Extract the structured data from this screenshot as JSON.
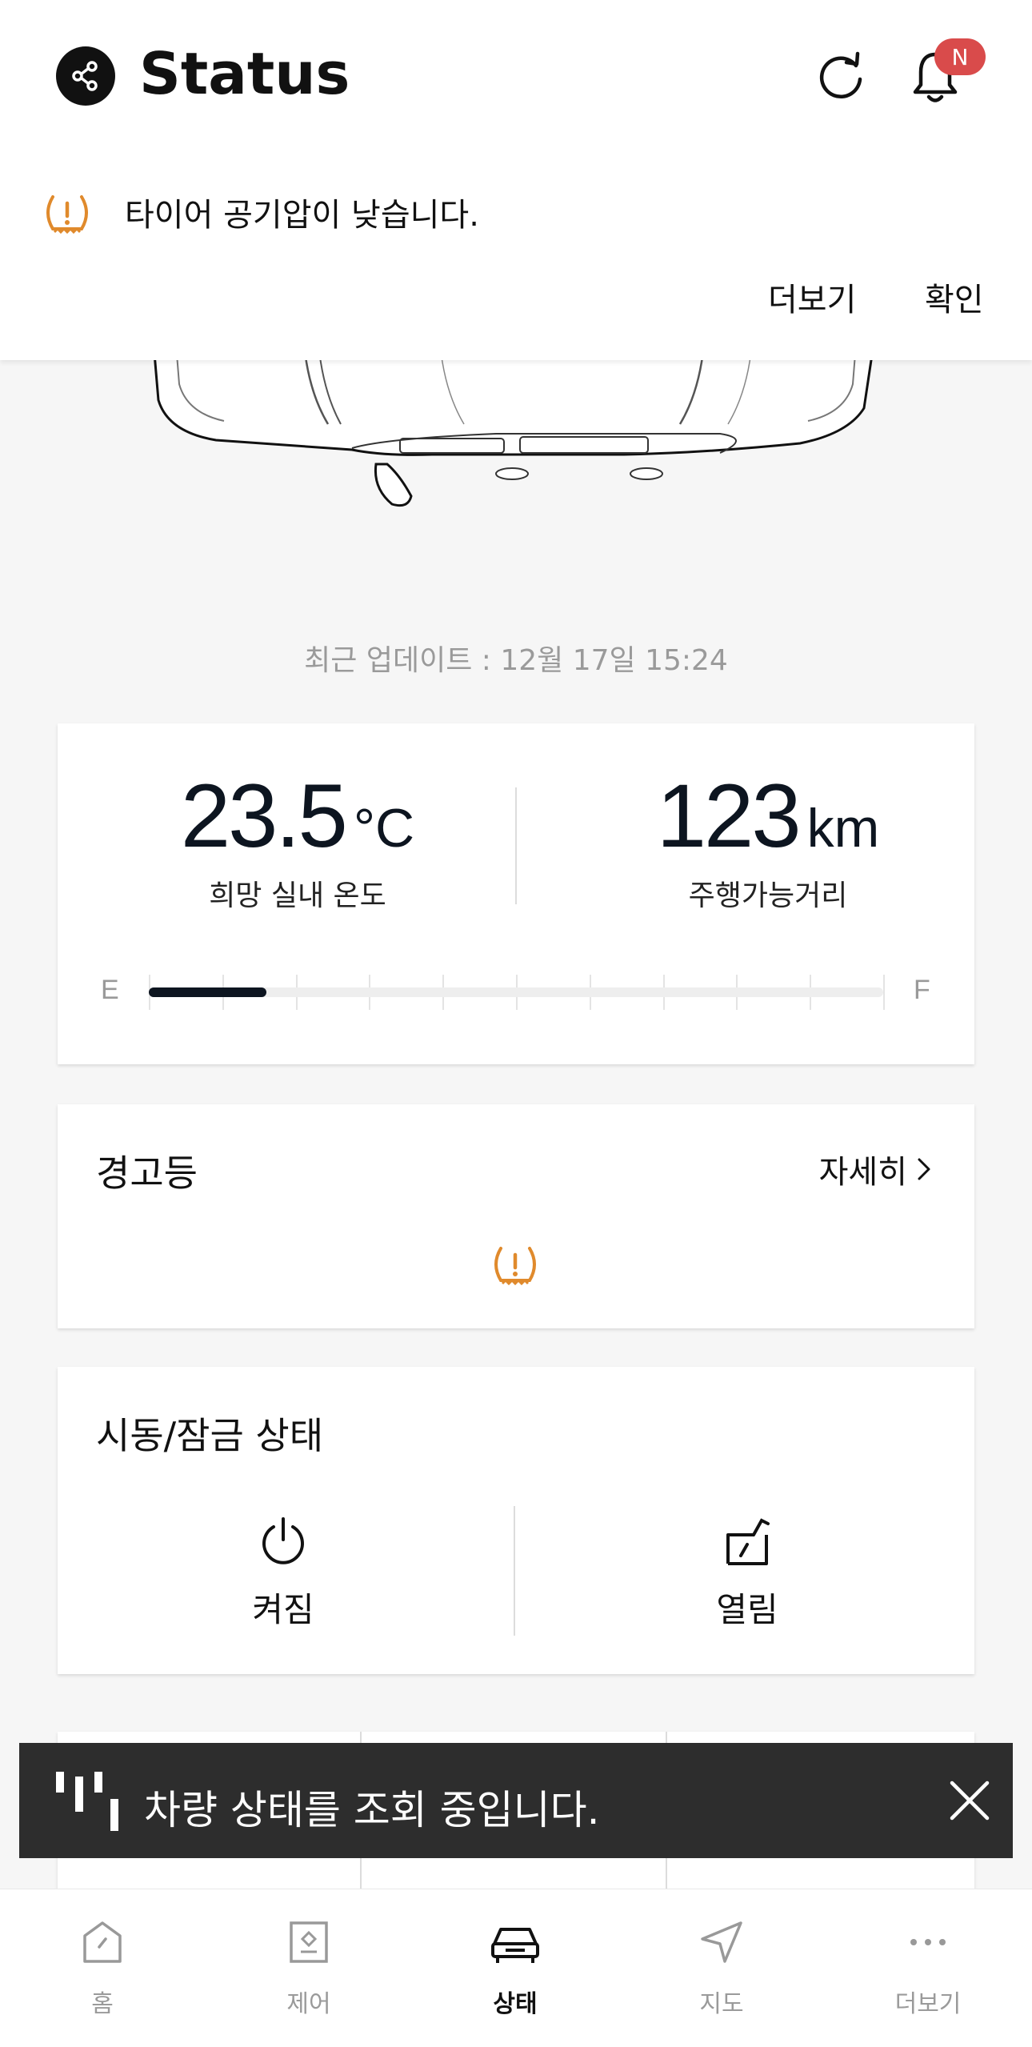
{
  "header": {
    "title": "Status",
    "notification_badge": "N",
    "alert": {
      "message": "타이어 공기압이 낮습니다.",
      "more_label": "더보기",
      "confirm_label": "확인",
      "icon": "tire-pressure-warning-icon",
      "color": "#e08a2c"
    }
  },
  "last_updated": "최근 업데이트 : 12월 17일 15:24",
  "climate": {
    "temperature_value": "23.5",
    "temperature_unit": "°C",
    "temperature_label": "희망 실내 온도",
    "range_value": "123",
    "range_unit": "km",
    "range_label": "주행가능거리"
  },
  "fuel": {
    "empty_label": "E",
    "full_label": "F",
    "level": 0.16
  },
  "warning_lights": {
    "title": "경고등",
    "detail_label": "자세히",
    "icons": [
      "tire-pressure-warning-icon"
    ]
  },
  "lock_status": {
    "title": "시동/잠금 상태",
    "engine_label": "켜짐",
    "door_label": "열림"
  },
  "toast": {
    "message": "차량 상태를 조회 중입니다.",
    "icon": "loading-bars-icon"
  },
  "nav": {
    "items": [
      {
        "label": "홈",
        "icon": "home-icon"
      },
      {
        "label": "제어",
        "icon": "control-icon"
      },
      {
        "label": "상태",
        "icon": "car-icon",
        "active": true
      },
      {
        "label": "지도",
        "icon": "navigation-arrow-icon"
      },
      {
        "label": "더보기",
        "icon": "more-dots-icon"
      }
    ]
  },
  "colors": {
    "accent_warning": "#e08a2c",
    "badge": "#d94b4b",
    "toast_bg": "#2d2d2d",
    "text_dark": "#0d1520"
  }
}
